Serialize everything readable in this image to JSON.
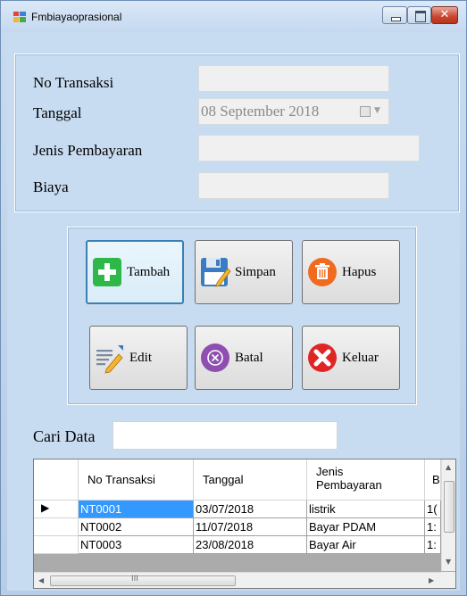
{
  "window": {
    "title": "Fmbiayaoprasional"
  },
  "form": {
    "no_transaksi_label": "No Transaksi",
    "tanggal_label": "Tanggal",
    "tanggal_value": "08 September 2018",
    "jenis_label": "Jenis Pembayaran",
    "biaya_label": "Biaya"
  },
  "buttons": {
    "tambah": "Tambah",
    "simpan": "Simpan",
    "hapus": "Hapus",
    "edit": "Edit",
    "batal": "Batal",
    "keluar": "Keluar"
  },
  "search": {
    "label": "Cari Data",
    "value": ""
  },
  "grid": {
    "headers": [
      "No Transaksi",
      "Tanggal",
      "Jenis Pembayaran",
      "B"
    ],
    "rows": [
      {
        "no": "NT0001",
        "tanggal": "03/07/2018",
        "jenis": "listrik",
        "biaya": "1("
      },
      {
        "no": "NT0002",
        "tanggal": "11/07/2018",
        "jenis": "Bayar PDAM",
        "biaya": "1:"
      },
      {
        "no": "NT0003",
        "tanggal": "23/08/2018",
        "jenis": "Bayar Air",
        "biaya": "1:"
      }
    ],
    "hscroll_mid": "III"
  },
  "colors": {
    "form_bg": "#c8dcf1",
    "selection": "#3399ff",
    "tambah_green": "#2eb84a",
    "hapus_orange": "#f06a1f",
    "batal_purple": "#8e4fb0",
    "keluar_red": "#e02525"
  },
  "icons": [
    "plus-icon",
    "save-icon",
    "trash-icon",
    "edit-icon",
    "cancel-icon",
    "close-x-icon"
  ]
}
